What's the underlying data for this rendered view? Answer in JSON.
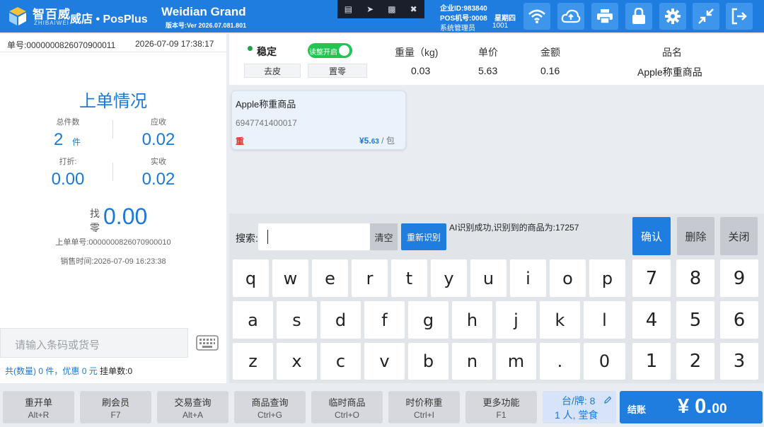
{
  "header": {
    "logo_cn": "智百威",
    "logo_en": "ZHIBAIWEI",
    "app_name": "威店 • PosPlus",
    "brand": "Weidian Grand",
    "version": "版本号:Ver 2026.07.081.801",
    "company_id": "企业ID:983840",
    "pos_no": "POS机号:0008",
    "weekday": "星期四",
    "admin": "系统管理员",
    "admin_code": "1001",
    "icons": [
      "wifi-icon",
      "cloud-upload-icon",
      "printer-icon",
      "lock-icon",
      "gear-icon",
      "minimize-icon",
      "exit-icon"
    ]
  },
  "order": {
    "number": "单号:0000000826070900011",
    "datetime": "2026-07-09 17:38:17",
    "title": "上单情况",
    "total_count_label": "总件数",
    "total_count": "2",
    "count_unit": "件",
    "receivable_label": "应收",
    "receivable": "0.02",
    "discount_label": "打折:",
    "discount": "0.00",
    "received_label": "实收",
    "received": "0.02",
    "change_label_1": "找",
    "change_label_2": "零",
    "change": "0.00",
    "prev_order": "上单单号:0000000826070900010",
    "sale_time": "销售时间:2026-07-09 16:23:38",
    "barcode_placeholder": "请输入条码或货号",
    "summary_prefix": "共(数量)",
    "summary_qty": "0",
    "summary_mid": "件，优惠",
    "summary_discount": "0",
    "summary_unit": "元",
    "suspend_label": "挂单数:0"
  },
  "scale": {
    "stable_label": "稳定",
    "mode_toggle": "读整开启",
    "tare_button": "去皮",
    "zero_button": "置零",
    "weight_label": "重量（kg)",
    "weight": "0.03",
    "unit_price_label": "单价",
    "unit_price": "5.63",
    "amount_label": "金额",
    "amount": "0.16",
    "name_label": "品名",
    "name": "Apple称重商品"
  },
  "product_card": {
    "name": "Apple称重商品",
    "barcode": "6947741400017",
    "tag": "重",
    "price_int": "¥5.",
    "price_dec": "63",
    "unit": "/ 包"
  },
  "search": {
    "label": "搜索:",
    "value": "",
    "clear_button": "清空",
    "rerecognize_button": "重新识别",
    "ai_status": "AI识别成功,识别到的商品为:17257",
    "confirm_button": "确认",
    "delete_button": "删除",
    "close_button": "关闭"
  },
  "keyboard": {
    "row1": [
      "q",
      "w",
      "e",
      "r",
      "t",
      "y",
      "u",
      "i",
      "o",
      "p"
    ],
    "row2": [
      "a",
      "s",
      "d",
      "f",
      "g",
      "h",
      "j",
      "k",
      "l"
    ],
    "row3": [
      "z",
      "x",
      "c",
      "v",
      "b",
      "n",
      "m",
      ".",
      "0"
    ],
    "numpad": [
      "7",
      "8",
      "9",
      "4",
      "5",
      "6",
      "1",
      "2",
      "3"
    ]
  },
  "functions": [
    {
      "label": "重开单",
      "key": "Alt+R"
    },
    {
      "label": "刷会员",
      "key": "F7"
    },
    {
      "label": "交易查询",
      "key": "Alt+A"
    },
    {
      "label": "商品查询",
      "key": "Ctrl+G"
    },
    {
      "label": "临时商品",
      "key": "Ctrl+O"
    },
    {
      "label": "时价称重",
      "key": "Ctrl+I"
    },
    {
      "label": "更多功能",
      "key": "F1"
    }
  ],
  "table": {
    "label": "台/牌: 8",
    "people": "1 人,  堂食"
  },
  "checkout": {
    "label": "结账",
    "amount_int": "¥ 0.",
    "amount_dec": "00"
  },
  "colors": {
    "primary": "#1f7de0",
    "accent_blue": "#1a78d9",
    "toggle_green": "#23c552",
    "tag_red": "#d9342b"
  }
}
